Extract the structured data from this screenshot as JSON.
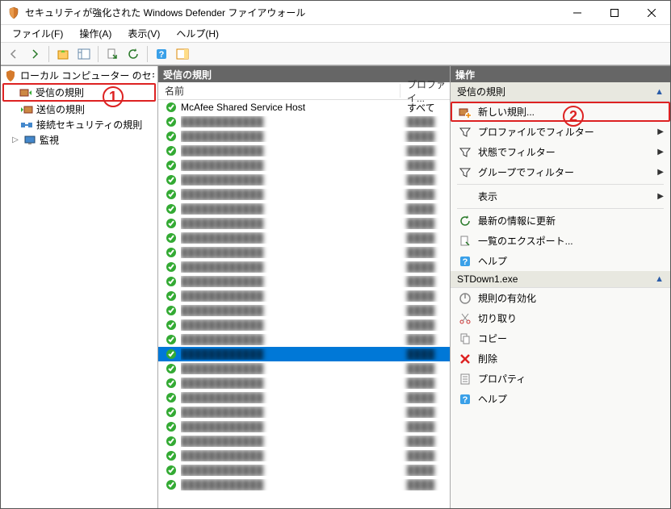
{
  "window": {
    "title": "セキュリティが強化された Windows Defender ファイアウォール"
  },
  "menu": {
    "file": "ファイル(F)",
    "action": "操作(A)",
    "view": "表示(V)",
    "help": "ヘルプ(H)"
  },
  "tree": {
    "root": "ローカル コンピューター のセキュリティ",
    "inbound": "受信の規則",
    "outbound": "送信の規則",
    "connsec": "接続セキュリティの規則",
    "monitor": "監視"
  },
  "center": {
    "header": "受信の規則",
    "col_name": "名前",
    "col_profile": "プロファイ...",
    "rows": [
      {
        "name": "McAfee Shared Service Host",
        "profile": "すべて",
        "checked": true
      }
    ],
    "blurred_count": 26,
    "selected_index": 16
  },
  "actions": {
    "header": "操作",
    "section1": "受信の規則",
    "new_rule": "新しい規則...",
    "filter_profile": "プロファイルでフィルター",
    "filter_state": "状態でフィルター",
    "filter_group": "グループでフィルター",
    "view": "表示",
    "refresh": "最新の情報に更新",
    "export": "一覧のエクスポート...",
    "help1": "ヘルプ",
    "section2": "STDown1.exe",
    "enable": "規則の有効化",
    "cut": "切り取り",
    "copy": "コピー",
    "delete": "削除",
    "properties": "プロパティ",
    "help2": "ヘルプ"
  },
  "callouts": {
    "one": "1",
    "two": "2"
  }
}
